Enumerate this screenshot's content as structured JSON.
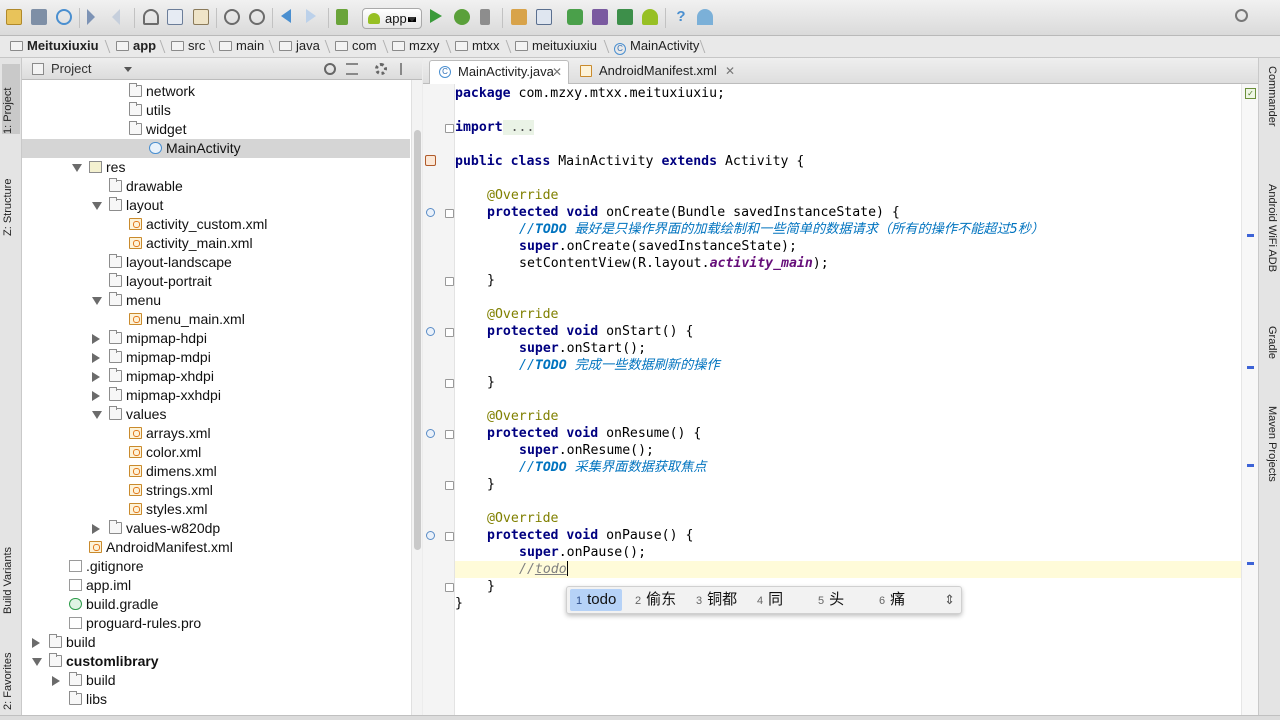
{
  "toolbar": {
    "run_config": "app"
  },
  "breadcrumb": [
    "Meituxiuxiu",
    "app",
    "src",
    "main",
    "java",
    "com",
    "mzxy",
    "mtxx",
    "meituxiuxiu",
    "MainActivity"
  ],
  "left_strip": {
    "project": "1: Project",
    "structure": "Z: Structure",
    "build_variants": "Build Variants",
    "favorites": "2: Favorites"
  },
  "right_strip": {
    "commander": "Commander",
    "wifi_adb": "Android WiFi ADB",
    "gradle": "Gradle",
    "maven": "Maven Projects"
  },
  "project_panel": {
    "title": "Project",
    "tree": [
      {
        "label": "network",
        "type": "folder",
        "indent": 4,
        "arrow": "none"
      },
      {
        "label": "utils",
        "type": "folder",
        "indent": 4,
        "arrow": "none"
      },
      {
        "label": "widget",
        "type": "folder",
        "indent": 4,
        "arrow": "none"
      },
      {
        "label": "MainActivity",
        "type": "class",
        "indent": 5,
        "arrow": "none",
        "selected": true
      },
      {
        "label": "res",
        "type": "res",
        "indent": 2,
        "arrow": "exp"
      },
      {
        "label": "drawable",
        "type": "folder",
        "indent": 3,
        "arrow": "none"
      },
      {
        "label": "layout",
        "type": "folder",
        "indent": 3,
        "arrow": "exp"
      },
      {
        "label": "activity_custom.xml",
        "type": "xml",
        "indent": 4,
        "arrow": "none"
      },
      {
        "label": "activity_main.xml",
        "type": "xml",
        "indent": 4,
        "arrow": "none"
      },
      {
        "label": "layout-landscape",
        "type": "folder",
        "indent": 3,
        "arrow": "none"
      },
      {
        "label": "layout-portrait",
        "type": "folder",
        "indent": 3,
        "arrow": "none"
      },
      {
        "label": "menu",
        "type": "folder",
        "indent": 3,
        "arrow": "exp"
      },
      {
        "label": "menu_main.xml",
        "type": "xml",
        "indent": 4,
        "arrow": "none"
      },
      {
        "label": "mipmap-hdpi",
        "type": "folder",
        "indent": 3,
        "arrow": "col"
      },
      {
        "label": "mipmap-mdpi",
        "type": "folder",
        "indent": 3,
        "arrow": "col"
      },
      {
        "label": "mipmap-xhdpi",
        "type": "folder",
        "indent": 3,
        "arrow": "col"
      },
      {
        "label": "mipmap-xxhdpi",
        "type": "folder",
        "indent": 3,
        "arrow": "col"
      },
      {
        "label": "values",
        "type": "folder",
        "indent": 3,
        "arrow": "exp"
      },
      {
        "label": "arrays.xml",
        "type": "xml",
        "indent": 4,
        "arrow": "none"
      },
      {
        "label": "color.xml",
        "type": "xml",
        "indent": 4,
        "arrow": "none"
      },
      {
        "label": "dimens.xml",
        "type": "xml",
        "indent": 4,
        "arrow": "none"
      },
      {
        "label": "strings.xml",
        "type": "xml",
        "indent": 4,
        "arrow": "none"
      },
      {
        "label": "styles.xml",
        "type": "xml",
        "indent": 4,
        "arrow": "none"
      },
      {
        "label": "values-w820dp",
        "type": "folder",
        "indent": 3,
        "arrow": "col"
      },
      {
        "label": "AndroidManifest.xml",
        "type": "xml",
        "indent": 2,
        "arrow": "none"
      },
      {
        "label": ".gitignore",
        "type": "file",
        "indent": 1,
        "arrow": "none"
      },
      {
        "label": "app.iml",
        "type": "file",
        "indent": 1,
        "arrow": "none"
      },
      {
        "label": "build.gradle",
        "type": "gradle",
        "indent": 1,
        "arrow": "none"
      },
      {
        "label": "proguard-rules.pro",
        "type": "file",
        "indent": 1,
        "arrow": "none"
      },
      {
        "label": "build",
        "type": "folder",
        "indent": 0,
        "arrow": "col"
      },
      {
        "label": "customlibrary",
        "type": "folder",
        "indent": 0,
        "arrow": "exp",
        "bold": true
      },
      {
        "label": "build",
        "type": "folder",
        "indent": 1,
        "arrow": "col"
      },
      {
        "label": "libs",
        "type": "folder",
        "indent": 1,
        "arrow": "none"
      }
    ]
  },
  "editor": {
    "tabs": [
      {
        "label": "MainActivity.java",
        "active": true
      },
      {
        "label": "AndroidManifest.xml",
        "active": false
      }
    ],
    "code": {
      "package_kw": "package",
      "package_name": " com.mzxy.mtxx.meituxiuxiu;",
      "import_kw": "import",
      "import_fold": " ...",
      "class_decl_kw": "public class",
      "class_name": " MainActivity ",
      "extends_kw": "extends",
      "base_class": " Activity {",
      "override": "@Override",
      "protected_void": "protected void",
      "on_create_sig": " onCreate(Bundle savedInstanceState) {",
      "todo_prefix": "//",
      "todo_word": "TODO",
      "on_create_todo": " 最好是只操作界面的加载绘制和一些简单的数据请求（所有的操作不能超过5秒）",
      "super_kw": "super",
      "on_create_super": ".onCreate(savedInstanceState);",
      "set_content_view": "setContentView(R.layout.",
      "activity_main": "activity_main",
      "close_paren": ");",
      "close_brace": "}",
      "on_start_sig": " onStart() {",
      "on_start_super": ".onStart();",
      "on_start_todo": " 完成一些数据刷新的操作",
      "on_resume_sig": " onResume() {",
      "on_resume_super": ".onResume();",
      "on_resume_todo": " 采集界面数据获取焦点",
      "on_pause_sig": " onPause() {",
      "on_pause_super": ".onPause();",
      "typing_prefix": "//",
      "typing_word": "todo"
    }
  },
  "ime": {
    "candidates": [
      {
        "num": "1",
        "text": "todo"
      },
      {
        "num": "2",
        "text": "偷东"
      },
      {
        "num": "3",
        "text": "铜都"
      },
      {
        "num": "4",
        "text": "同"
      },
      {
        "num": "5",
        "text": "头"
      },
      {
        "num": "6",
        "text": "痛"
      }
    ]
  }
}
